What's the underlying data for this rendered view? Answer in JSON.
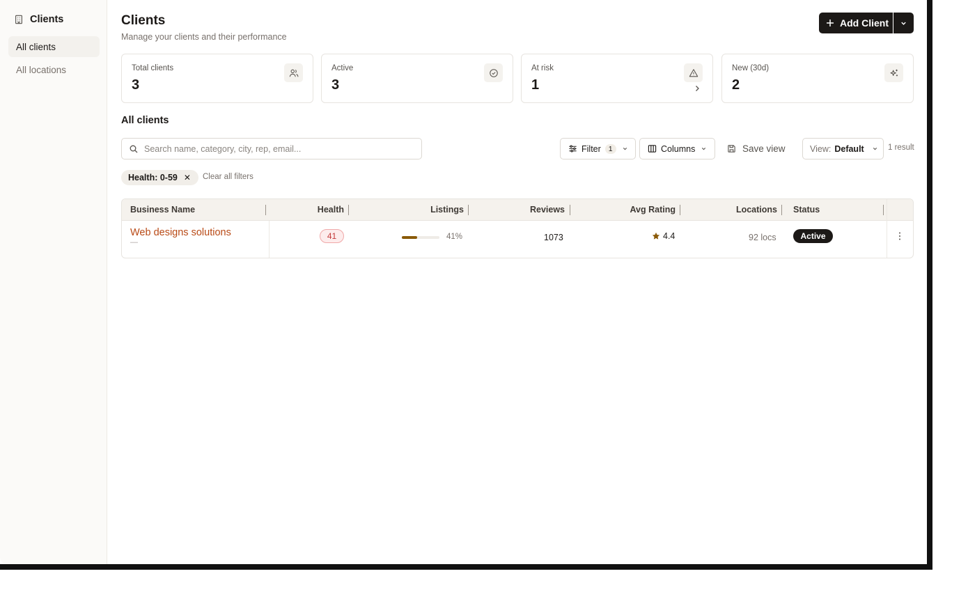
{
  "sidebar": {
    "title": "Clients",
    "items": [
      {
        "label": "All clients",
        "active": true
      },
      {
        "label": "All locations",
        "active": false
      }
    ]
  },
  "header": {
    "title": "Clients",
    "subtitle": "Manage your clients and their performance",
    "add_button": "Add Client"
  },
  "stats": [
    {
      "label": "Total clients",
      "value": "3",
      "icon": "users-icon"
    },
    {
      "label": "Active",
      "value": "3",
      "icon": "check-circle-icon"
    },
    {
      "label": "At risk",
      "value": "1",
      "icon": "alert-triangle-icon"
    },
    {
      "label": "New (30d)",
      "value": "2",
      "icon": "sparkles-icon"
    }
  ],
  "section": {
    "title": "All clients"
  },
  "toolbar": {
    "search_placeholder": "Search name, category, city, rep, email...",
    "filter_label": "Filter",
    "filter_count": "1",
    "columns_label": "Columns",
    "save_view_label": "Save view",
    "view_label": "View:",
    "view_value": "Default",
    "result_count": "1 result"
  },
  "filters": {
    "chip_label": "Health: 0-59",
    "clear_label": "Clear all filters"
  },
  "table": {
    "columns": [
      "Business Name",
      "Health",
      "Listings",
      "Reviews",
      "Avg Rating",
      "Locations",
      "Status"
    ],
    "rows": [
      {
        "name": "Web designs solutions",
        "sub": "—",
        "health": "41",
        "listings_pct": 41,
        "listings_label": "41%",
        "reviews": "1073",
        "rating": "4.4",
        "locations": "92 locs",
        "status": "Active"
      }
    ]
  },
  "colors": {
    "accent": "#1c1917",
    "link": "#b94a16",
    "health_bad": "#c43a3a",
    "bar_fill": "#8a5a08",
    "star": "#8a5a08"
  }
}
